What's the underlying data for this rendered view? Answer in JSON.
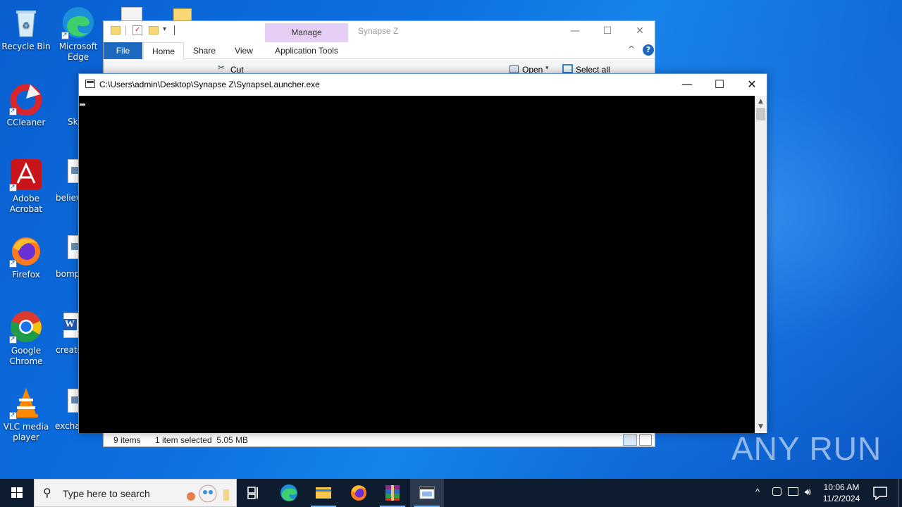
{
  "desktop": {
    "icons": [
      {
        "label": "Recycle Bin"
      },
      {
        "label": "Microsoft Edge"
      },
      {
        "label": "CCleaner"
      },
      {
        "label": "Adobe Acrobat"
      },
      {
        "label": "Firefox"
      },
      {
        "label": "Google Chrome"
      },
      {
        "label": "VLC media player"
      }
    ],
    "partial_labels": [
      "Sky",
      "believ",
      "bomp",
      "create",
      "exchar"
    ]
  },
  "explorer": {
    "title": "Synapse Z",
    "contextual_tab": "Manage",
    "tabs": [
      "File",
      "Home",
      "Share",
      "View",
      "Application Tools"
    ],
    "ribbon": {
      "cut": "Cut",
      "open": "Open",
      "select_all": "Select all"
    },
    "status": {
      "items": "9 items",
      "selected": "1 item selected  5.05 MB"
    },
    "colors": {
      "file_tab": "#1d69c0",
      "manage_tab": "#e5cff5"
    }
  },
  "console": {
    "title": "C:\\Users\\admin\\Desktop\\Synapse Z\\SynapseLauncher.exe",
    "background": "#000000"
  },
  "watermark": "ANY RUN",
  "taskbar": {
    "search_placeholder": "Type here to search",
    "apps": [
      "task-view",
      "edge",
      "file-explorer",
      "firefox",
      "winrar",
      "console"
    ],
    "clock": {
      "time": "10:06 AM",
      "date": "11/2/2024"
    }
  }
}
